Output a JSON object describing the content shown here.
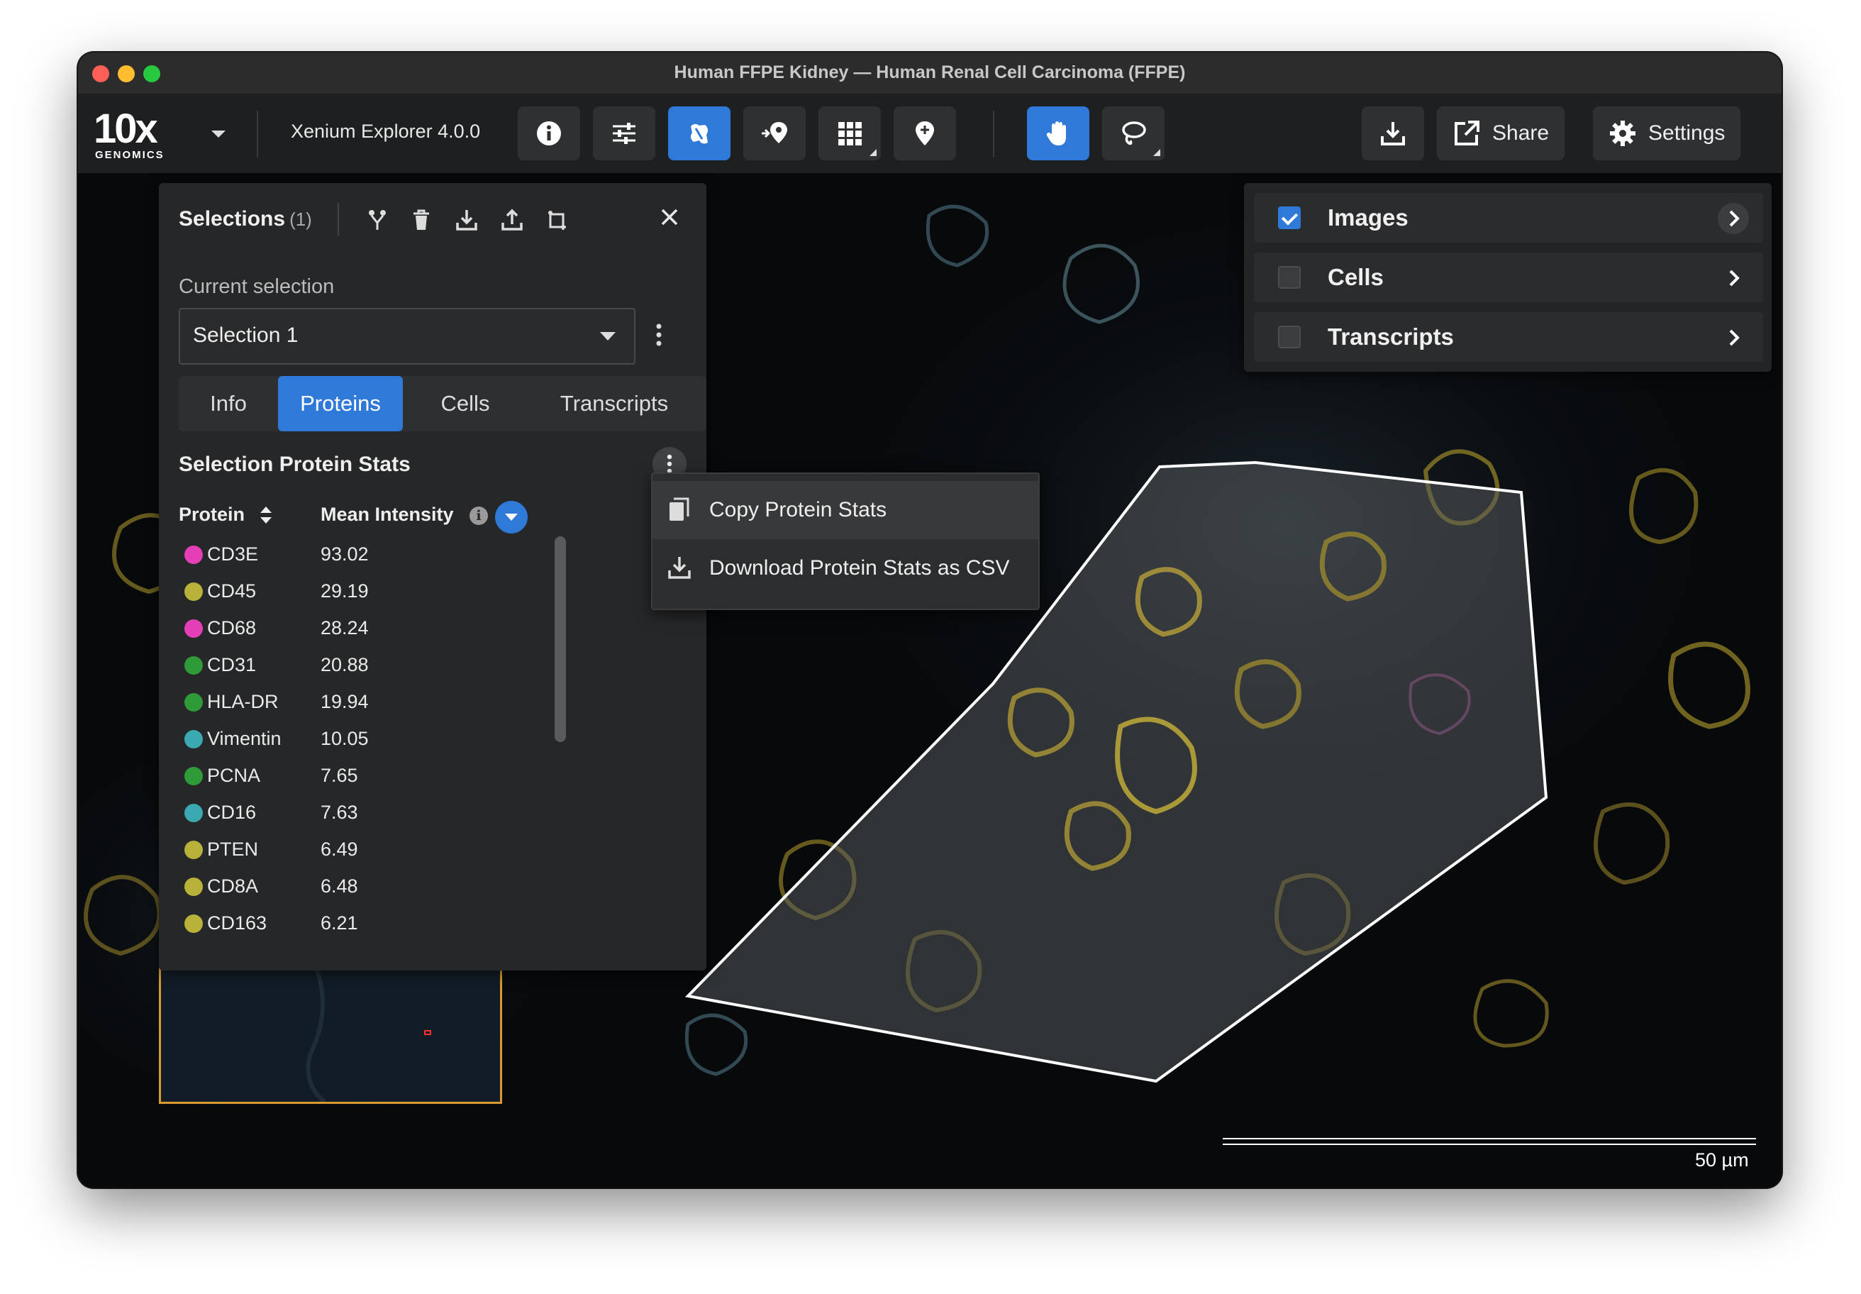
{
  "window": {
    "title": "Human FFPE Kidney — Human Renal Cell Carcinoma (FFPE)"
  },
  "toolbar": {
    "logo_big": "10x",
    "logo_small": "GENOMICS",
    "app_name": "Xenium Explorer 4.0.0",
    "tools": [
      {
        "icon": "info-icon",
        "active": false
      },
      {
        "icon": "sliders-icon",
        "active": false
      },
      {
        "icon": "selection-tool-icon",
        "active": true
      },
      {
        "icon": "add-pin-icon",
        "active": false
      },
      {
        "icon": "grid-icon",
        "active": false,
        "has_menu": true
      },
      {
        "icon": "map-pin-icon",
        "active": false
      },
      {
        "icon": "hand-icon",
        "active": true
      },
      {
        "icon": "lasso-icon",
        "active": false,
        "has_menu": true
      }
    ],
    "download_icon": "download-icon",
    "share_label": "Share",
    "settings_label": "Settings"
  },
  "selections_panel": {
    "title": "Selections",
    "count": "(1)",
    "current_label": "Current selection",
    "current_value": "Selection 1",
    "tabs": [
      "Info",
      "Proteins",
      "Cells",
      "Transcripts"
    ],
    "active_tab": "Proteins",
    "stats_title": "Selection Protein Stats",
    "col_protein": "Protein",
    "col_mean": "Mean Intensity",
    "rows": [
      {
        "protein": "CD3E",
        "value": "93.02",
        "color": "#e53fb8"
      },
      {
        "protein": "CD45",
        "value": "29.19",
        "color": "#b9b23a"
      },
      {
        "protein": "CD68",
        "value": "28.24",
        "color": "#e53fb8"
      },
      {
        "protein": "CD31",
        "value": "20.88",
        "color": "#2f9a38"
      },
      {
        "protein": "HLA-DR",
        "value": "19.94",
        "color": "#2f9a38"
      },
      {
        "protein": "Vimentin",
        "value": "10.05",
        "color": "#3aa9b0"
      },
      {
        "protein": "PCNA",
        "value": "7.65",
        "color": "#2f9a38"
      },
      {
        "protein": "CD16",
        "value": "7.63",
        "color": "#3aa9b0"
      },
      {
        "protein": "PTEN",
        "value": "6.49",
        "color": "#b9b23a"
      },
      {
        "protein": "CD8A",
        "value": "6.48",
        "color": "#b9b23a"
      },
      {
        "protein": "CD163",
        "value": "6.21",
        "color": "#b9b23a"
      }
    ]
  },
  "context_menu": {
    "items": [
      {
        "label": "Copy Protein Stats",
        "icon": "copy-icon"
      },
      {
        "label": "Download Protein Stats as CSV",
        "icon": "download-icon"
      }
    ]
  },
  "layers": [
    {
      "label": "Images",
      "checked": true
    },
    {
      "label": "Cells",
      "checked": false
    },
    {
      "label": "Transcripts",
      "checked": false
    }
  ],
  "scale": {
    "label": "50  µm"
  },
  "accent": "#2f79d8"
}
